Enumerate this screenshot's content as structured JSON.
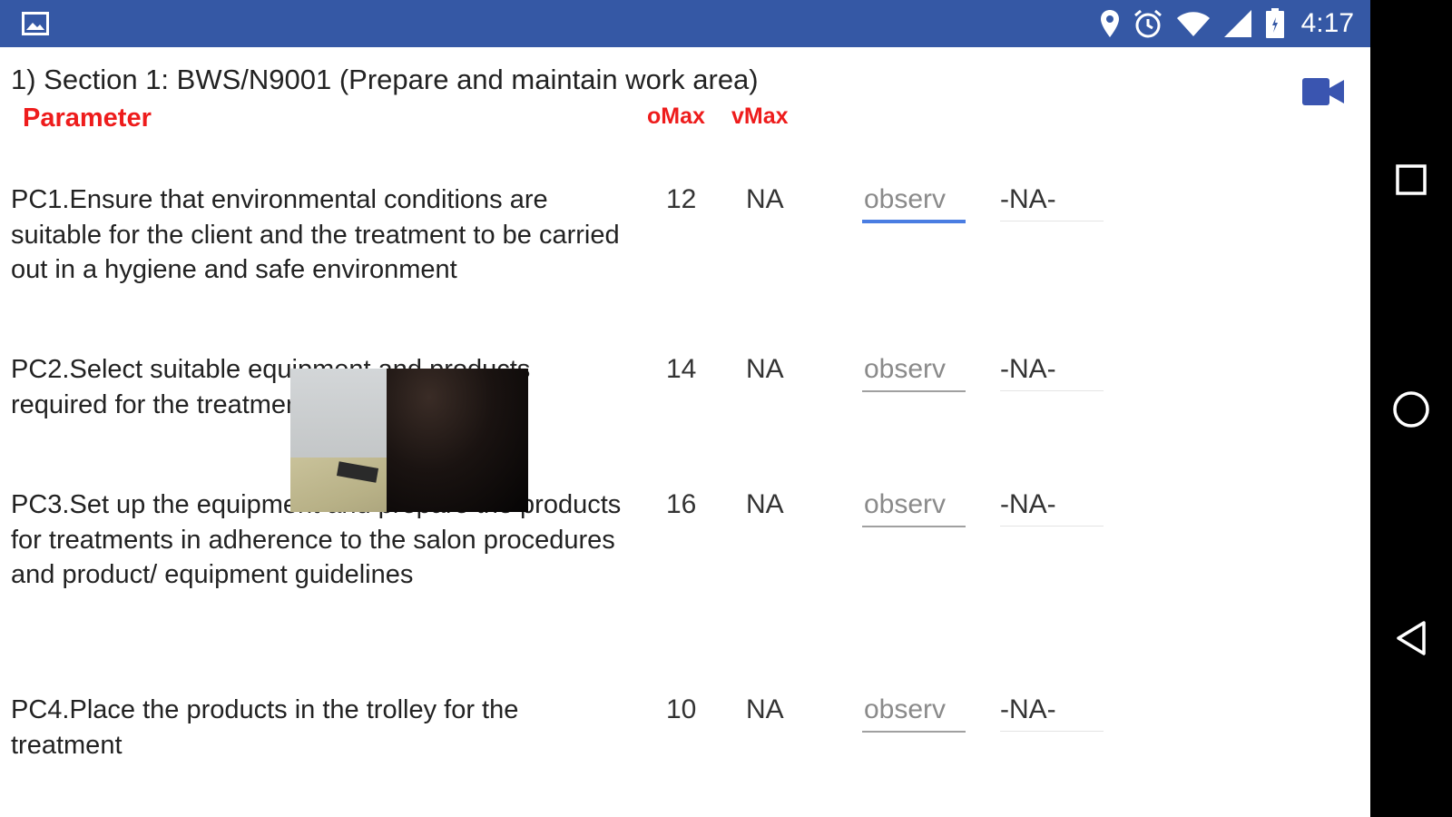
{
  "status_bar": {
    "time": "4:17",
    "icons": [
      "gallery-icon",
      "location-pin-icon",
      "alarm-icon",
      "wifi-icon",
      "cell-signal-icon",
      "battery-icon"
    ],
    "color": "#3558a5"
  },
  "nav_bar": {
    "icons": [
      "recents-square-icon",
      "home-circle-icon",
      "back-triangle-icon"
    ]
  },
  "section": {
    "title": "1) Section 1: BWS/N9001 (Prepare and maintain work area)",
    "header_param": "Parameter",
    "header_omax": "oMax",
    "header_vmax": "vMax",
    "header_color": "#ee1c1c",
    "video_icon": "video-camera-icon"
  },
  "rows": [
    {
      "text": "PC1.Ensure that environmental conditions are suitable for the client and the treatment to be carried out in a hygiene and safe environment",
      "omax": "12",
      "vmax": "NA",
      "obs_placeholder": "observ",
      "na": "-NA-",
      "focused": true
    },
    {
      "text": "PC2.Select suitable equipment and products required for the treatment",
      "omax": "14",
      "vmax": "NA",
      "obs_placeholder": "observ",
      "na": "-NA-",
      "focused": false
    },
    {
      "text": "PC3.Set up the equipment and prepare the products for treatments in adherence to the salon procedures and product/ equipment guidelines",
      "omax": "16",
      "vmax": "NA",
      "obs_placeholder": "observ",
      "na": "-NA-",
      "focused": false
    },
    {
      "text": "PC4.Place the products in the trolley for the treatment",
      "omax": "10",
      "vmax": "NA",
      "obs_placeholder": "observ",
      "na": "-NA-",
      "focused": false
    }
  ],
  "accent_color": "#4a7de2"
}
